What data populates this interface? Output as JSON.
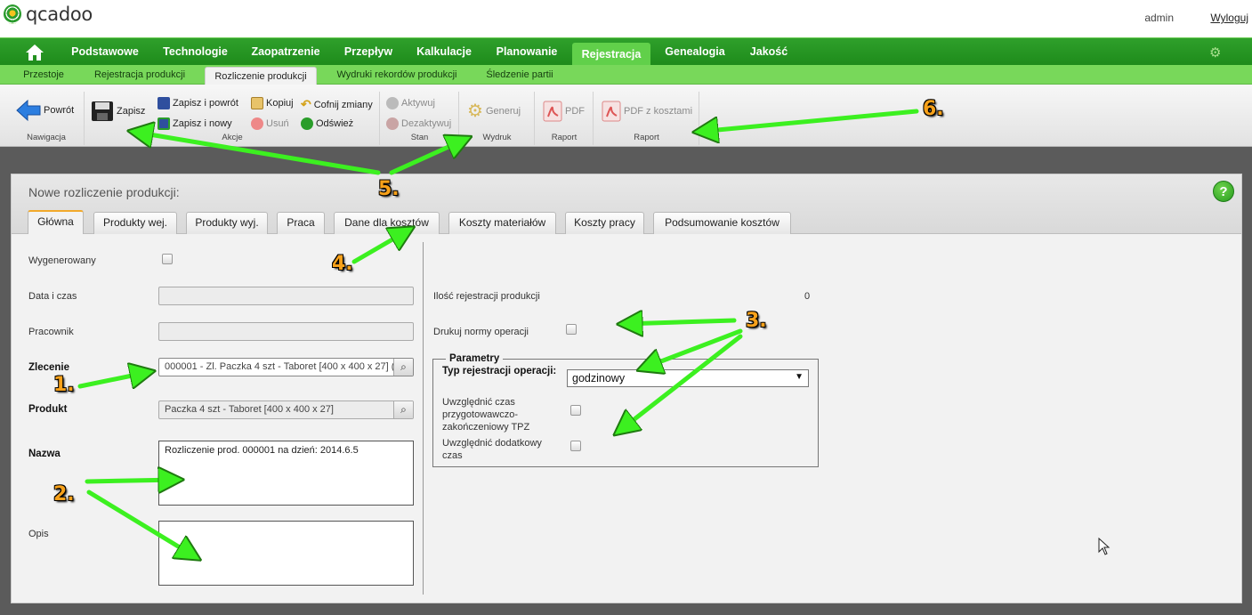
{
  "app": {
    "logo_text": "qcadoo",
    "user": "admin",
    "logout": "Wyloguj"
  },
  "main_menu": [
    "Podstawowe",
    "Technologie",
    "Zaopatrzenie",
    "Przepływ",
    "Kalkulacje",
    "Planowanie",
    "Rejestracja",
    "Genealogia",
    "Jakość"
  ],
  "main_menu_active": "Rejestracja",
  "sub_menu": [
    "Przestoje",
    "Rejestracja produkcji",
    "Rozliczenie produkcji",
    "Wydruki rekordów produkcji",
    "Śledzenie partii"
  ],
  "sub_menu_active": "Rozliczenie produkcji",
  "ribbon": {
    "nawigacja": {
      "label": "Nawigacja",
      "back": "Powrót"
    },
    "akcje": {
      "label": "Akcje",
      "save": "Zapisz",
      "save_back": "Zapisz i powrót",
      "save_new": "Zapisz i nowy",
      "copy": "Kopiuj",
      "delete": "Usuń",
      "undo": "Cofnij zmiany",
      "refresh": "Odśwież"
    },
    "stan": {
      "label": "Stan",
      "activate": "Aktywuj",
      "deactivate": "Dezaktywuj"
    },
    "wydruk": {
      "label": "Wydruk",
      "generate": "Generuj"
    },
    "raport1": {
      "label": "Raport",
      "pdf": "PDF"
    },
    "raport2": {
      "label": "Raport",
      "pdf_costs": "PDF z kosztami"
    }
  },
  "form": {
    "title": "Nowe rozliczenie produkcji:",
    "tabs": [
      "Główna",
      "Produkty wej.",
      "Produkty wyj.",
      "Praca",
      "Dane dla kosztów",
      "Koszty materiałów",
      "Koszty pracy",
      "Podsumowanie kosztów"
    ],
    "active_tab": "Główna",
    "labels": {
      "generated": "Wygenerowany",
      "datetime": "Data i czas",
      "worker": "Pracownik",
      "order": "Zlecenie",
      "product": "Produkt",
      "name": "Nazwa",
      "description": "Opis",
      "record_count": "Ilość rejestracji produkcji",
      "print_norms": "Drukuj normy operacji",
      "params_legend": "Parametry",
      "registration_type": "Typ rejestracji operacji:",
      "include_tpz": "Uwzględnić czas przygotowawczo-zakończeniowy TPZ",
      "include_extra": "Uwzględnić dodatkowy czas"
    },
    "values": {
      "order": "000001 - Zl. Paczka 4 szt - Taboret [400 x 400 x 27] (",
      "product": "Paczka 4 szt - Taboret [400 x 400 x 27]",
      "name": "Rozliczenie prod. 000001 na dzień: 2014.6.5",
      "record_count": "0",
      "registration_type": "godzinowy"
    }
  },
  "callouts": [
    "1.",
    "2.",
    "3.",
    "4.",
    "5.",
    "6."
  ],
  "colors": {
    "menu_green": "#1e8b1b",
    "active_green": "#61d04a",
    "callout_orange": "#f7a11a",
    "arrow_green": "#3cf020"
  }
}
